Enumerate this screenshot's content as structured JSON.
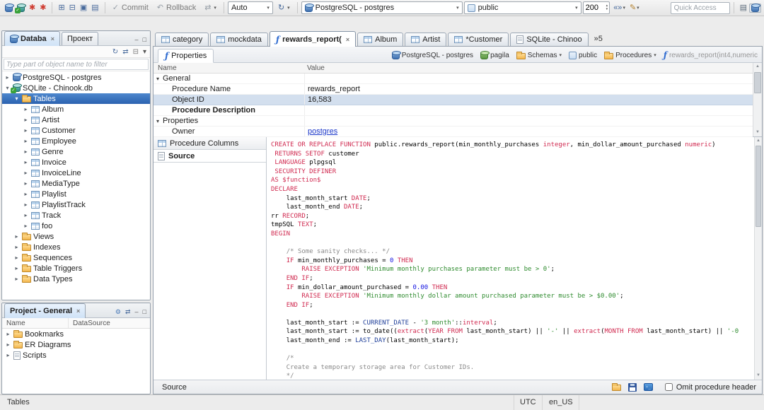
{
  "colors": {
    "keyword": "#d02a50",
    "string": "#2e8b2e",
    "number": "#1414e0",
    "comment": "#8a8a8a",
    "function": "#1f3f99",
    "selection": "#2f6cc4",
    "link": "#1a36c8",
    "accent": "#3875d7"
  },
  "toolbar": {
    "commit_label": "Commit",
    "rollback_label": "Rollback",
    "auto_label": "Auto",
    "connection_label": "PostgreSQL - postgres",
    "schema_label": "public",
    "fetch_size": "200",
    "quick_access_placeholder": "Quick Access"
  },
  "icon_strips": {
    "tb-connect": [
      {
        "name": "new-connection-icon",
        "kind": "cyl"
      },
      {
        "name": "connect-database-icon",
        "kind": "cylt"
      },
      {
        "name": "new-sql-editor-icon",
        "kind": "glyph",
        "glyph": "✱",
        "color": "#cf3b30"
      },
      {
        "name": "recent-sql-editor-icon",
        "kind": "glyph",
        "glyph": "✱",
        "color": "#cf3b30"
      }
    ],
    "tb-windows": [
      {
        "name": "sql-console-window-icon",
        "kind": "glyph",
        "glyph": "⊞",
        "color": "#47699b"
      },
      {
        "name": "output-window-icon",
        "kind": "glyph",
        "glyph": "⊟",
        "color": "#47699b"
      },
      {
        "name": "results-window-icon",
        "kind": "glyph",
        "glyph": "▣",
        "color": "#47699b"
      },
      {
        "name": "layout-window-icon",
        "kind": "glyph",
        "glyph": "▤",
        "color": "#47699b"
      }
    ],
    "tb-extra": [
      {
        "name": "sql-templates-icon",
        "kind": "glyph",
        "glyph": "«»",
        "color": "#47699b",
        "caret": true
      },
      {
        "name": "edit-value-icon",
        "kind": "glyph",
        "glyph": "✎",
        "color": "#b3812f",
        "caret": true
      }
    ],
    "tb-right": [
      {
        "name": "open-perspective-icon",
        "kind": "glyph",
        "glyph": "▤",
        "color": "#5a6a7a"
      },
      {
        "name": "dbeaver-perspective-icon",
        "kind": "cyl",
        "pressed": true
      }
    ],
    "nav-toolbar": [
      {
        "name": "refresh-tree-icon",
        "kind": "glyph",
        "glyph": "↻",
        "color": "#47699b"
      },
      {
        "name": "link-with-editor-icon",
        "kind": "glyph",
        "glyph": "⇄",
        "color": "#47699b"
      },
      {
        "name": "collapse-all-icon",
        "kind": "glyph",
        "glyph": "⊟",
        "color": "#7a7a7a"
      },
      {
        "name": "view-menu-icon",
        "kind": "glyph",
        "glyph": "▾",
        "color": "#555555"
      }
    ],
    "nav-corner": [
      {
        "name": "minimize-panel-icon",
        "kind": "glyph",
        "glyph": "–",
        "color": "#555555"
      },
      {
        "name": "maximize-panel-icon",
        "kind": "glyph",
        "glyph": "□",
        "color": "#555555"
      }
    ],
    "project-toolbar": [
      {
        "name": "project-settings-icon",
        "kind": "glyph",
        "glyph": "⚙",
        "color": "#4a7ab8"
      },
      {
        "name": "link-project-icon",
        "kind": "glyph",
        "glyph": "⇄",
        "color": "#47699b"
      },
      {
        "name": "minimize-project-icon",
        "kind": "glyph",
        "glyph": "–",
        "color": "#555555"
      },
      {
        "name": "maximize-project-icon",
        "kind": "glyph",
        "glyph": "□",
        "color": "#555555"
      }
    ],
    "editor-bottom-icons": [
      {
        "name": "open-file-icon",
        "kind": "folder"
      },
      {
        "name": "save-to-file-icon",
        "kind": "floppy"
      },
      {
        "name": "open-in-sql-editor-icon",
        "kind": "console"
      }
    ]
  },
  "navigator": {
    "tabs": [
      {
        "label": "Databa",
        "active": true,
        "close": true,
        "icon": "cyl"
      },
      {
        "label": "Проект",
        "active": false
      }
    ],
    "filter_placeholder": "Type part of object name to filter",
    "tree": [
      {
        "label": "PostgreSQL - postgres",
        "level": 0,
        "icon": "cyl",
        "exp": "collapsed"
      },
      {
        "label": "SQLite - Chinook.db",
        "level": 0,
        "icon": "cylt",
        "exp": "expanded"
      },
      {
        "label": "Tables",
        "level": 1,
        "icon": "folder",
        "exp": "expanded",
        "selected": true
      },
      {
        "label": "Album",
        "level": 2,
        "icon": "table",
        "exp": "collapsed"
      },
      {
        "label": "Artist",
        "level": 2,
        "icon": "table",
        "exp": "collapsed"
      },
      {
        "label": "Customer",
        "level": 2,
        "icon": "table",
        "exp": "collapsed"
      },
      {
        "label": "Employee",
        "level": 2,
        "icon": "table",
        "exp": "collapsed"
      },
      {
        "label": "Genre",
        "level": 2,
        "icon": "table",
        "exp": "collapsed"
      },
      {
        "label": "Invoice",
        "level": 2,
        "icon": "table",
        "exp": "collapsed"
      },
      {
        "label": "InvoiceLine",
        "level": 2,
        "icon": "table",
        "exp": "collapsed"
      },
      {
        "label": "MediaType",
        "level": 2,
        "icon": "table",
        "exp": "collapsed"
      },
      {
        "label": "Playlist",
        "level": 2,
        "icon": "table",
        "exp": "collapsed"
      },
      {
        "label": "PlaylistTrack",
        "level": 2,
        "icon": "table",
        "exp": "collapsed"
      },
      {
        "label": "Track",
        "level": 2,
        "icon": "table",
        "exp": "collapsed"
      },
      {
        "label": "foo",
        "level": 2,
        "icon": "table",
        "exp": "collapsed"
      },
      {
        "label": "Views",
        "level": 1,
        "icon": "folder",
        "exp": "collapsed"
      },
      {
        "label": "Indexes",
        "level": 1,
        "icon": "folder",
        "exp": "collapsed"
      },
      {
        "label": "Sequences",
        "level": 1,
        "icon": "folder",
        "exp": "collapsed"
      },
      {
        "label": "Table Triggers",
        "level": 1,
        "icon": "folder",
        "exp": "collapsed"
      },
      {
        "label": "Data Types",
        "level": 1,
        "icon": "folder",
        "exp": "collapsed"
      }
    ]
  },
  "project": {
    "tabs": [
      {
        "label": "Project - General",
        "active": true,
        "close": true
      }
    ],
    "columns": [
      "Name",
      "DataSource"
    ],
    "rows": [
      {
        "label": "Bookmarks",
        "icon": "folder",
        "exp": "collapsed"
      },
      {
        "label": "ER Diagrams",
        "icon": "folder",
        "exp": "collapsed"
      },
      {
        "label": "Scripts",
        "icon": "page",
        "exp": "collapsed"
      }
    ]
  },
  "editor": {
    "tabs": [
      {
        "label": "category",
        "icon": "table"
      },
      {
        "label": "mockdata",
        "icon": "table"
      },
      {
        "label": "rewards_report(",
        "icon": "fn",
        "active": true,
        "close": true
      },
      {
        "label": "Album",
        "icon": "table"
      },
      {
        "label": "Artist",
        "icon": "table"
      },
      {
        "label": "*Customer",
        "icon": "table"
      },
      {
        "label": "SQLite - Chinoo",
        "icon": "page"
      }
    ],
    "overflow_label": "»5",
    "properties_tab": "Properties",
    "breadcrumb": [
      {
        "label": "PostgreSQL - postgres",
        "icon": "cyl"
      },
      {
        "label": "pagila",
        "icon": "cylg"
      },
      {
        "label": "Schemas",
        "icon": "folder",
        "dropdown": true
      },
      {
        "label": "public",
        "icon": "schema"
      },
      {
        "label": "Procedures",
        "icon": "folder",
        "dropdown": true
      },
      {
        "label": "rewards_report(int4,numeric",
        "icon": "fn",
        "muted": true
      }
    ],
    "grid": {
      "columns": [
        "Name",
        "Value"
      ],
      "rows": [
        {
          "kind": "group",
          "name": "General"
        },
        {
          "kind": "prop",
          "name": "Procedure Name",
          "value": "rewards_report"
        },
        {
          "kind": "prop",
          "name": "Object ID",
          "value": "16,583",
          "selected": true
        },
        {
          "kind": "prop",
          "name": "Procedure Description",
          "value": "",
          "bold": true
        },
        {
          "kind": "group",
          "name": "Properties"
        },
        {
          "kind": "prop",
          "name": "Owner",
          "value": "postgres",
          "link": true
        }
      ]
    },
    "side_tabs": [
      {
        "label": "Procedure Columns",
        "icon": "table"
      },
      {
        "label": "Source",
        "icon": "page",
        "active": true
      }
    ],
    "bottom": {
      "current_tab": "Source",
      "omit_checkbox_label": "Omit procedure header"
    }
  },
  "source": {
    "lines": [
      [
        [
          "CREATE OR REPLACE FUNCTION",
          "k"
        ],
        [
          " public.rewards_report(min_monthly_purchases ",
          "p"
        ],
        [
          "integer",
          "k"
        ],
        [
          ", min_dollar_amount_purchased ",
          "p"
        ],
        [
          "numeric",
          "k"
        ],
        [
          ")",
          "p"
        ]
      ],
      [
        [
          " RETURNS SETOF",
          "k"
        ],
        [
          " customer",
          "p"
        ]
      ],
      [
        [
          " LANGUAGE",
          "k"
        ],
        [
          " plpgsql",
          "p"
        ]
      ],
      [
        [
          " SECURITY DEFINER",
          "k"
        ]
      ],
      [
        [
          "AS",
          "k"
        ],
        [
          " ",
          "p"
        ],
        [
          "$function$",
          "k"
        ]
      ],
      [
        [
          "DECLARE",
          "k"
        ]
      ],
      [
        [
          "    last_month_start ",
          "p"
        ],
        [
          "DATE",
          "k"
        ],
        [
          ";",
          "p"
        ]
      ],
      [
        [
          "    last_month_end ",
          "p"
        ],
        [
          "DATE",
          "k"
        ],
        [
          ";",
          "p"
        ]
      ],
      [
        [
          "rr ",
          "p"
        ],
        [
          "RECORD",
          "k"
        ],
        [
          ";",
          "p"
        ]
      ],
      [
        [
          "tmpSQL ",
          "p"
        ],
        [
          "TEXT",
          "k"
        ],
        [
          ";",
          "p"
        ]
      ],
      [
        [
          "BEGIN",
          "k"
        ]
      ],
      [],
      [
        [
          "    ",
          "p"
        ],
        [
          "/* Some sanity checks... */",
          "c"
        ]
      ],
      [
        [
          "    ",
          "p"
        ],
        [
          "IF",
          "k"
        ],
        [
          " min_monthly_purchases = ",
          "p"
        ],
        [
          "0",
          "n"
        ],
        [
          " ",
          "p"
        ],
        [
          "THEN",
          "k"
        ]
      ],
      [
        [
          "        ",
          "p"
        ],
        [
          "RAISE EXCEPTION",
          "k"
        ],
        [
          " ",
          "p"
        ],
        [
          "'Minimum monthly purchases parameter must be > 0'",
          "s"
        ],
        [
          ";",
          "p"
        ]
      ],
      [
        [
          "    ",
          "p"
        ],
        [
          "END IF",
          "k"
        ],
        [
          ";",
          "p"
        ]
      ],
      [
        [
          "    ",
          "p"
        ],
        [
          "IF",
          "k"
        ],
        [
          " min_dollar_amount_purchased = ",
          "p"
        ],
        [
          "0.00",
          "n"
        ],
        [
          " ",
          "p"
        ],
        [
          "THEN",
          "k"
        ]
      ],
      [
        [
          "        ",
          "p"
        ],
        [
          "RAISE EXCEPTION",
          "k"
        ],
        [
          " ",
          "p"
        ],
        [
          "'Minimum monthly dollar amount purchased parameter must be > $0.00'",
          "s"
        ],
        [
          ";",
          "p"
        ]
      ],
      [
        [
          "    ",
          "p"
        ],
        [
          "END IF",
          "k"
        ],
        [
          ";",
          "p"
        ]
      ],
      [],
      [
        [
          "    last_month_start := ",
          "p"
        ],
        [
          "CURRENT_DATE",
          "f"
        ],
        [
          " - ",
          "p"
        ],
        [
          "'3 month'",
          "s"
        ],
        [
          "::",
          "p"
        ],
        [
          "interval",
          "k"
        ],
        [
          ";",
          "p"
        ]
      ],
      [
        [
          "    last_month_start := to_date((",
          "p"
        ],
        [
          "extract",
          "k"
        ],
        [
          "(",
          "p"
        ],
        [
          "YEAR FROM",
          "k"
        ],
        [
          " last_month_start) || ",
          "p"
        ],
        [
          "'-'",
          "s"
        ],
        [
          " || ",
          "p"
        ],
        [
          "extract",
          "k"
        ],
        [
          "(",
          "p"
        ],
        [
          "MONTH FROM",
          "k"
        ],
        [
          " last_month_start) || ",
          "p"
        ],
        [
          "'-0",
          "s"
        ]
      ],
      [
        [
          "    last_month_end := ",
          "p"
        ],
        [
          "LAST_DAY",
          "f"
        ],
        [
          "(last_month_start);",
          "p"
        ]
      ],
      [],
      [
        [
          "    ",
          "p"
        ],
        [
          "/*",
          "c"
        ]
      ],
      [
        [
          "    Create a temporary storage area for Customer IDs.",
          "c"
        ]
      ],
      [
        [
          "    ",
          "p"
        ],
        [
          "*/",
          "c"
        ]
      ]
    ]
  },
  "statusbar": {
    "left": "Tables",
    "timezone": "UTC",
    "locale": "en_US"
  }
}
